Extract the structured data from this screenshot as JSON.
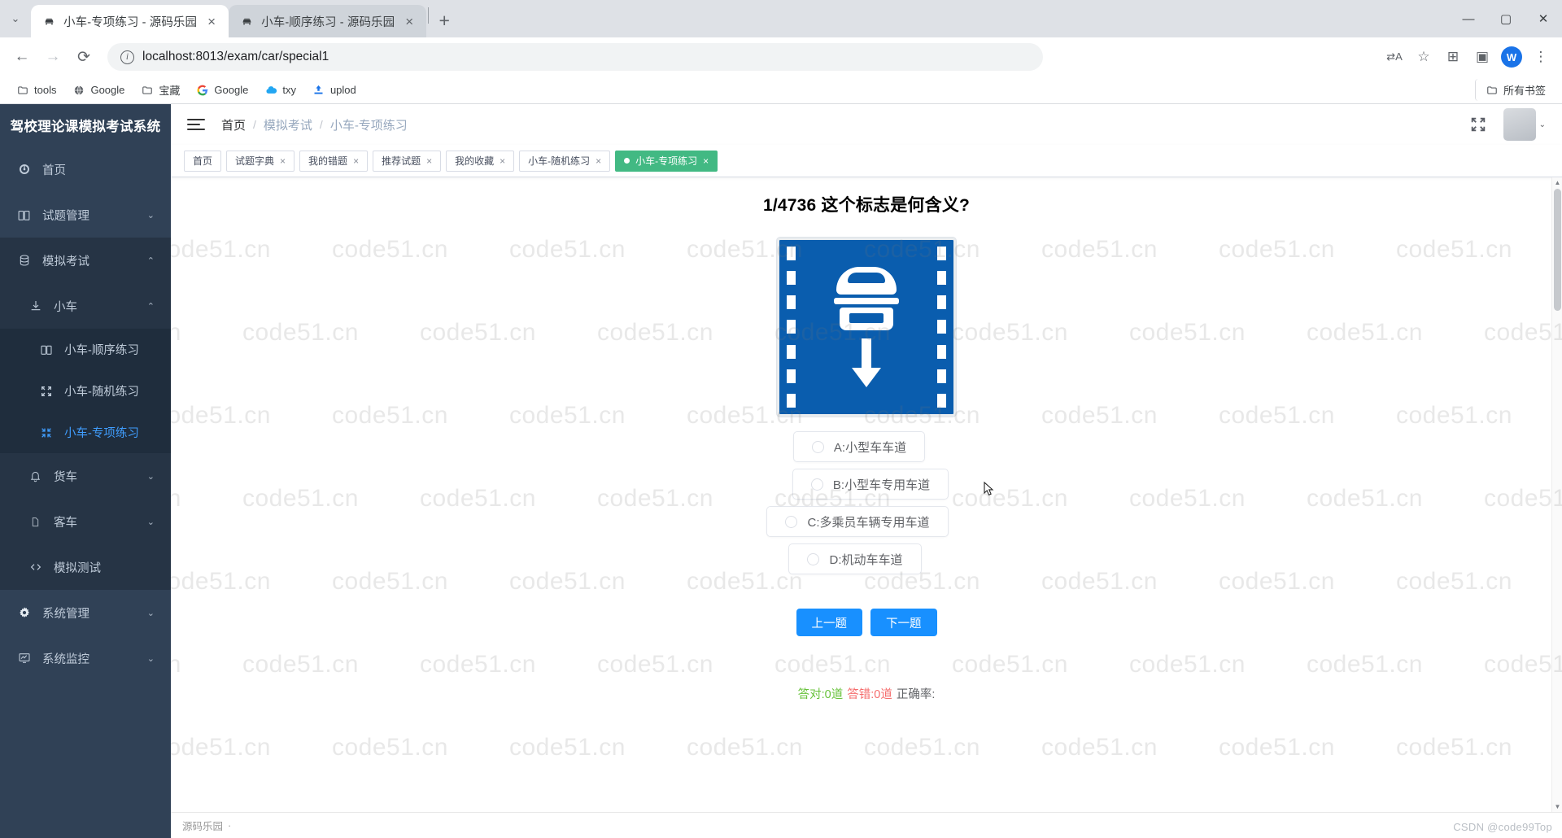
{
  "browser": {
    "tabs": [
      {
        "title": "小车-专项练习 - 源码乐园",
        "active": true,
        "favicon": "car-icon",
        "close": "×"
      },
      {
        "title": "小车-顺序练习 - 源码乐园",
        "active": false,
        "favicon": "car-icon",
        "close": "×"
      }
    ],
    "new_tab_label": "+",
    "tabstrip_chevron": "⌄",
    "window_controls": {
      "minimize": "—",
      "maximize": "▢",
      "close": "✕"
    },
    "nav": {
      "back": "←",
      "forward": "→",
      "reload": "⟳"
    },
    "url": "localhost:8013/exam/car/special1",
    "url_info_icon": "i",
    "omni_icons": {
      "translate": "⇄A",
      "bookmark_star": "☆",
      "extensions": "⊞",
      "sidepanel": "▣",
      "menu": "⋮"
    },
    "profile_initial": "W",
    "bookmarks": [
      {
        "label": "tools",
        "icon": "folder-icon"
      },
      {
        "label": "Google",
        "icon": "globe-icon"
      },
      {
        "label": "宝藏",
        "icon": "folder-icon"
      },
      {
        "label": "Google",
        "icon": "google-icon"
      },
      {
        "label": "txy",
        "icon": "cloud-icon"
      },
      {
        "label": "uplod",
        "icon": "upload-icon"
      }
    ],
    "all_bookmarks": {
      "label": "所有书签",
      "icon": "folder-icon"
    }
  },
  "sidebar": {
    "title": "驾校理论课模拟考试系统",
    "items": [
      {
        "label": "首页",
        "icon": "dashboard-icon",
        "arrow": "",
        "level": 1,
        "state": "normal"
      },
      {
        "label": "试题管理",
        "icon": "book-icon",
        "arrow": "⌄",
        "level": 1,
        "state": "normal"
      },
      {
        "label": "模拟考试",
        "icon": "database-icon",
        "arrow": "⌃",
        "level": 1,
        "state": "open"
      },
      {
        "label": "小车",
        "icon": "download-icon",
        "arrow": "⌃",
        "level": 2,
        "state": "open"
      },
      {
        "label": "小车-顺序练习",
        "icon": "book-icon",
        "arrow": "",
        "level": 3,
        "state": "normal"
      },
      {
        "label": "小车-随机练习",
        "icon": "expand-icon",
        "arrow": "",
        "level": 3,
        "state": "normal"
      },
      {
        "label": "小车-专项练习",
        "icon": "collapse-icon",
        "arrow": "",
        "level": 3,
        "state": "active"
      },
      {
        "label": "货车",
        "icon": "bell-icon",
        "arrow": "⌄",
        "level": 2,
        "state": "normal"
      },
      {
        "label": "客车",
        "icon": "doc-icon",
        "arrow": "⌄",
        "level": 2,
        "state": "normal"
      },
      {
        "label": "模拟测试",
        "icon": "code-icon",
        "arrow": "",
        "level": 2,
        "state": "normal"
      },
      {
        "label": "系统管理",
        "icon": "gear-icon",
        "arrow": "⌄",
        "level": 1,
        "state": "normal"
      },
      {
        "label": "系统监控",
        "icon": "monitor-icon",
        "arrow": "⌄",
        "level": 1,
        "state": "normal"
      }
    ]
  },
  "navbar": {
    "hamburger": "menu-fold-icon",
    "breadcrumb": [
      {
        "label": "首页",
        "type": "home"
      },
      {
        "label": "模拟考试",
        "type": "mid"
      },
      {
        "label": "小车-专项练习",
        "type": "last"
      }
    ],
    "separator": "/",
    "screenfull_icon": "fullscreen-icon",
    "avatar": "user-avatar",
    "caret": "⌄"
  },
  "view_tabs": [
    {
      "label": "首页",
      "closable": false,
      "active": false
    },
    {
      "label": "试题字典",
      "closable": true,
      "active": false
    },
    {
      "label": "我的错题",
      "closable": true,
      "active": false
    },
    {
      "label": "推荐试题",
      "closable": true,
      "active": false
    },
    {
      "label": "我的收藏",
      "closable": true,
      "active": false
    },
    {
      "label": "小车-随机练习",
      "closable": true,
      "active": false
    },
    {
      "label": "小车-专项练习",
      "closable": true,
      "active": true
    }
  ],
  "tab_close_glyph": "×",
  "question": {
    "index_label": "1/4736",
    "text": "这个标志是何含义?",
    "full_title": "1/4736 这个标志是何含义?",
    "sign": {
      "type": "hov-lane-sign",
      "background_color": "#0a5dae",
      "description": "蓝色方形标志，白色小车与向下箭头，两侧白色虚线边框"
    },
    "options": [
      {
        "key": "A",
        "label": "A:小型车车道",
        "selected": false
      },
      {
        "key": "B",
        "label": "B:小型车专用车道",
        "selected": false
      },
      {
        "key": "C",
        "label": "C:多乘员车辆专用车道",
        "selected": false
      },
      {
        "key": "D",
        "label": "D:机动车车道",
        "selected": false
      }
    ]
  },
  "buttons": {
    "prev": "上一题",
    "next": "下一题"
  },
  "score": {
    "correct": "答对:0道",
    "wrong": "答错:0道",
    "rate": "正确率:"
  },
  "footer": {
    "brand": "源码乐园",
    "separator": "·"
  },
  "watermark": {
    "text": "code51.cn",
    "csdn": "CSDN @code99Top"
  },
  "colors": {
    "sidebar_bg": "#304156",
    "sidebar_sub_bg": "#1f2d3d",
    "accent_blue": "#409eff",
    "tab_active_green": "#42b983",
    "button_blue": "#1890ff",
    "sign_blue": "#0a5dae",
    "correct_green": "#67c23a",
    "wrong_red": "#f56c6c"
  }
}
